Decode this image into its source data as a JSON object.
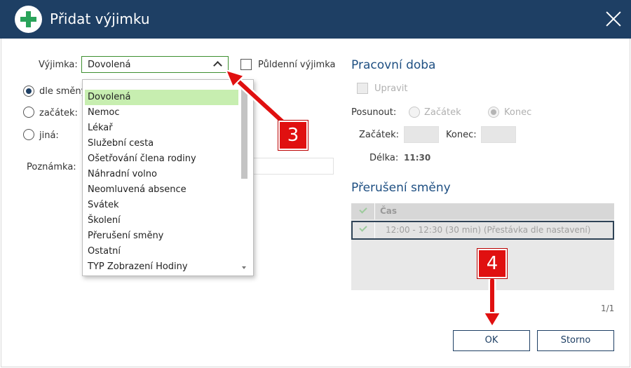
{
  "window": {
    "title": "Přidat výjimku",
    "icon": "plus-icon",
    "close_icon": "close-icon"
  },
  "form": {
    "exception_label": "Výjimka:",
    "exception_value": "Dovolená",
    "half_day_label": "Půldenní výjimka",
    "radio_by_shift": "dle směny",
    "radio_start": "začátek:",
    "radio_other": "jiná:",
    "note_label": "Poznámka:"
  },
  "dropdown": {
    "items": [
      "Dovolená",
      "Nemoc",
      "Lékař",
      "Služební cesta",
      "Ošetřování člena rodiny",
      "Náhradní volno",
      "Neomluvená absence",
      "Svátek",
      "Školení",
      "Přerušení směny",
      "Ostatní",
      "TYP Zobrazení Hodiny"
    ],
    "selected_index": 0
  },
  "working_time": {
    "title": "Pracovní doba",
    "edit_label": "Upravit",
    "shift_label": "Posunout:",
    "shift_start": "Začátek",
    "shift_end": "Konec",
    "start_label": "Začátek:",
    "end_label": "Konec:",
    "length_label": "Délka:",
    "length_value": "11:30"
  },
  "breaks": {
    "title": "Přerušení směny",
    "column_time": "Čas",
    "rows": [
      "12:00 - 12:30 (30 min) (Přestávka dle nastavení)"
    ],
    "pager": "1/1"
  },
  "buttons": {
    "ok": "OK",
    "cancel": "Storno"
  },
  "callouts": {
    "three": "3",
    "four": "4"
  },
  "colors": {
    "titlebar": "#1e3f64",
    "accent_green": "#2aa35a",
    "callout_red": "#e01010",
    "selected_item": "#c7eeb0"
  }
}
